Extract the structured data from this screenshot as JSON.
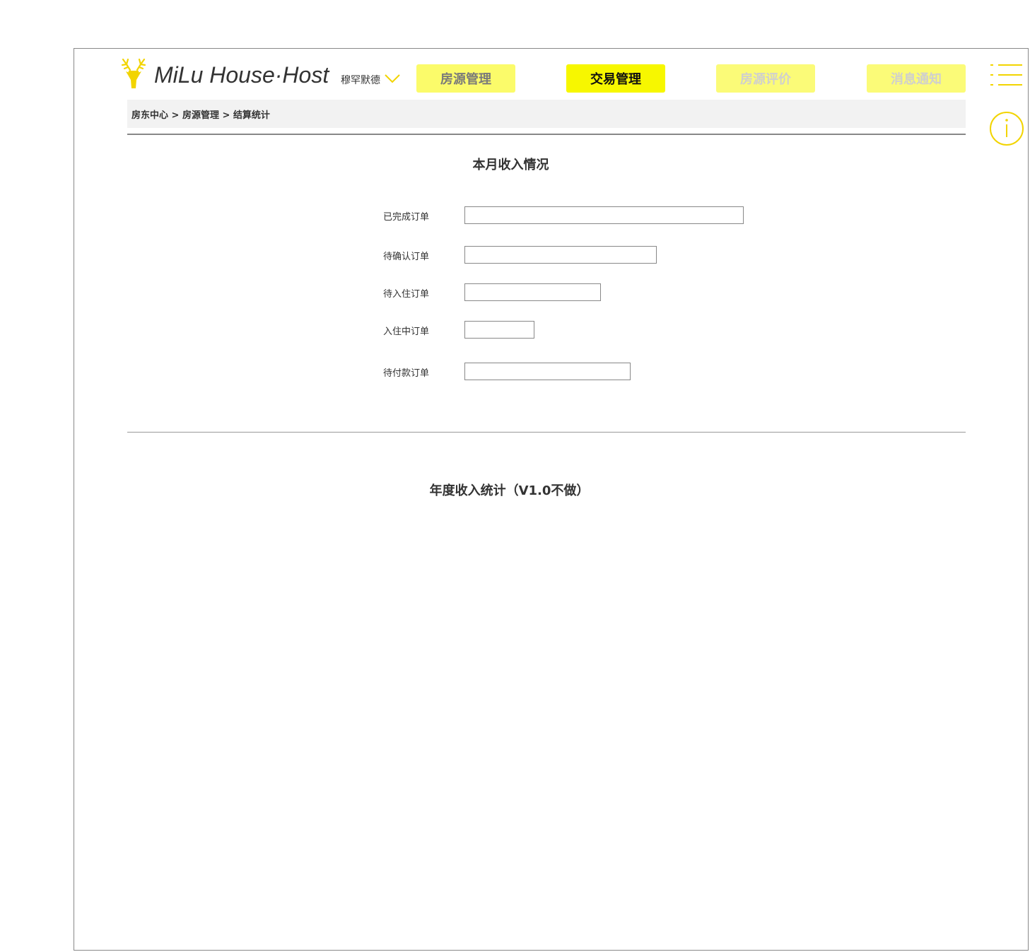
{
  "header": {
    "brand": "MiLu House·Host",
    "user_name": "穆罕默德",
    "tabs": [
      {
        "label": "房源管理",
        "state": "inactive"
      },
      {
        "label": "交易管理",
        "state": "active"
      },
      {
        "label": "房源评价",
        "state": "disabled"
      },
      {
        "label": "消息通知",
        "state": "disabled"
      }
    ],
    "accent_color": "#f7f700",
    "icons": [
      "deer-logo-icon",
      "chevron-down-icon",
      "menu-icon",
      "info-icon"
    ]
  },
  "breadcrumb": {
    "text": "房东中心 > 房源管理 > 结算统计"
  },
  "monthly": {
    "title": "本月收入情况",
    "rows": [
      {
        "label": "已完成订单",
        "value": ""
      },
      {
        "label": "待确认订单",
        "value": ""
      },
      {
        "label": "待入住订单",
        "value": ""
      },
      {
        "label": "入住中订单",
        "value": ""
      },
      {
        "label": "待付款订单",
        "value": ""
      }
    ]
  },
  "annual": {
    "title": "年度收入统计（V1.0不做）"
  }
}
